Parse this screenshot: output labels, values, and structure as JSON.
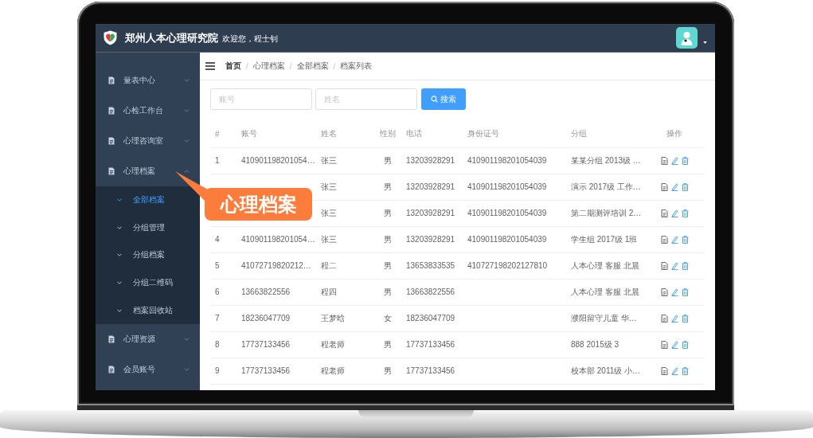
{
  "header": {
    "title": "郑州人本心理研究院",
    "welcome": "欢迎您，程士钊"
  },
  "sidebar": {
    "items": [
      {
        "label": "量表中心",
        "expanded": false
      },
      {
        "label": "心检工作台",
        "expanded": false
      },
      {
        "label": "心理咨询室",
        "expanded": false
      },
      {
        "label": "心理档案",
        "expanded": true,
        "children": [
          {
            "label": "全部档案",
            "selected": true
          },
          {
            "label": "分组管理",
            "selected": false
          },
          {
            "label": "分组档案",
            "selected": false
          },
          {
            "label": "分组二维码",
            "selected": false
          },
          {
            "label": "档案回收站",
            "selected": false
          }
        ]
      },
      {
        "label": "心理资源",
        "expanded": false
      },
      {
        "label": "会员账号",
        "expanded": false
      }
    ]
  },
  "breadcrumb": {
    "items": [
      "首页",
      "心理档案",
      "全部档案",
      "档案列表"
    ],
    "separators": [
      "/",
      "/",
      "/"
    ]
  },
  "search": {
    "fields": [
      {
        "placeholder": "账号"
      },
      {
        "placeholder": "姓名"
      }
    ],
    "button": "搜索"
  },
  "table": {
    "columns": [
      "#",
      "账号",
      "姓名",
      "性别",
      "电话",
      "身份证号",
      "分组",
      "操作"
    ],
    "rows": [
      {
        "index": "1",
        "account": "410901198201054…",
        "name": "张三",
        "gender": "男",
        "phone": "13203928291",
        "id_number": "410901198201054039",
        "group": "某某分组 2013级 …"
      },
      {
        "name": "张三",
        "gender": "男",
        "phone": "13203928291",
        "id_number": "410901198201054039",
        "group": "演示 2017级 工作…"
      },
      {
        "name": "张三",
        "gender": "男",
        "phone": "13203928291",
        "id_number": "410901198201054039",
        "group": "第二期测评培训 2…"
      },
      {
        "index": "4",
        "account": "410901198201054…",
        "name": "张三",
        "gender": "男",
        "phone": "13203928291",
        "id_number": "410901198201054039",
        "group": "学生组 2017级 1班"
      },
      {
        "index": "5",
        "account": "41072719820212…",
        "name": "程二",
        "gender": "男",
        "phone": "13653833535",
        "id_number": "410727198202127810",
        "group": "人本心理 客服 北晨"
      },
      {
        "index": "6",
        "account": "13663822556",
        "name": "程四",
        "gender": "男",
        "phone": "13663822556",
        "group": "人本心理 客服 北晨"
      },
      {
        "index": "7",
        "account": "18236047709",
        "name": "王梦晗",
        "gender": "女",
        "phone": "18236047709",
        "group": "濮阳留守儿童 华…"
      },
      {
        "index": "8",
        "account": "17737133456",
        "name": "程老师",
        "gender": "男",
        "phone": "17737133456",
        "group": "888 2015级 3"
      },
      {
        "index": "9",
        "account": "17737133456",
        "name": "程老师",
        "gender": "男",
        "phone": "17737133456",
        "group": "校本部 2011级 小…"
      }
    ]
  },
  "callout": {
    "text": "心理档案"
  }
}
